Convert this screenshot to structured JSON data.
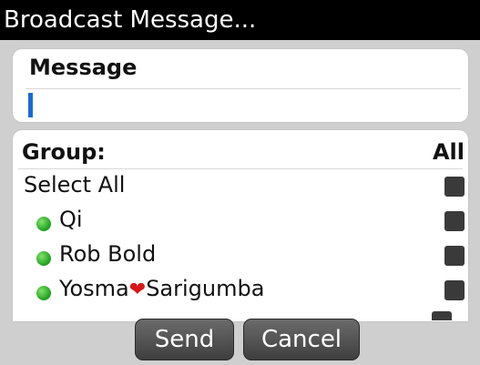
{
  "window": {
    "title": "Broadcast Message..."
  },
  "message": {
    "label": "Message",
    "value": ""
  },
  "group": {
    "header": "Group:",
    "all_label": "All",
    "select_all_label": "Select All",
    "contacts": [
      {
        "name": "Qi",
        "status_color": "#2fb52f"
      },
      {
        "name": "Rob Bold",
        "status_color": "#2fb52f"
      },
      {
        "name_before": "Yosma",
        "heart": "❤",
        "name_after": "Sarigumba",
        "status_color": "#2fb52f"
      }
    ]
  },
  "buttons": {
    "send": "Send",
    "cancel": "Cancel"
  }
}
